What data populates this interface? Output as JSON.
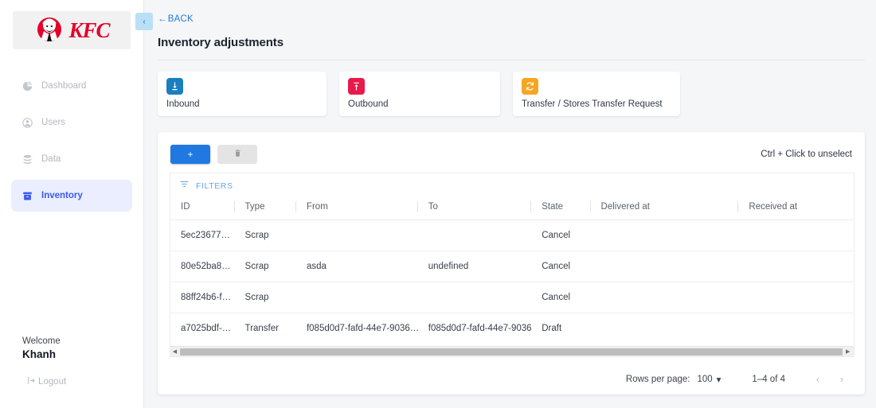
{
  "sidebar": {
    "brand": {
      "name": "KFC",
      "logo_alt": "kfc-logo"
    },
    "collapse_label": "‹",
    "items": [
      {
        "label": "Dashboard",
        "icon": "pie-chart-icon",
        "active": false
      },
      {
        "label": "Users",
        "icon": "user-icon",
        "active": false
      },
      {
        "label": "Data",
        "icon": "database-icon",
        "active": false
      },
      {
        "label": "Inventory",
        "icon": "inventory-box-icon",
        "active": true
      }
    ],
    "footer": {
      "welcome_label": "Welcome",
      "user_name": "Khanh",
      "logout_label": "Logout",
      "logout_icon": "logout-icon"
    }
  },
  "header": {
    "back_label": "BACK",
    "back_icon": "arrow-left-icon",
    "page_title": "Inventory adjustments"
  },
  "cards": [
    {
      "label": "Inbound",
      "icon": "download-inbound-icon",
      "color": "#1a7fc1"
    },
    {
      "label": "Outbound",
      "icon": "upload-outbound-icon",
      "color": "#e8194b"
    },
    {
      "label": "Transfer / Stores Transfer Request",
      "icon": "refresh-transfer-icon",
      "color": "#f5a623"
    }
  ],
  "toolbar": {
    "add_label": "+",
    "delete_icon": "trash-icon",
    "hint_text": "Ctrl + Click to unselect"
  },
  "table": {
    "filters_label": "FILTERS",
    "filters_icon": "filter-icon",
    "columns": [
      "ID",
      "Type",
      "From",
      "To",
      "State",
      "Delivered at",
      "Received at"
    ],
    "rows": [
      {
        "id": "5ec23677…",
        "type": "Scrap",
        "from": "",
        "to": "",
        "state": "Cancel",
        "delivered_at": "",
        "received_at": ""
      },
      {
        "id": "80e52ba8…",
        "type": "Scrap",
        "from": "asda",
        "to": "undefined",
        "state": "Cancel",
        "delivered_at": "",
        "received_at": ""
      },
      {
        "id": "88ff24b6-f…",
        "type": "Scrap",
        "from": "",
        "to": "",
        "state": "Cancel",
        "delivered_at": "",
        "received_at": ""
      },
      {
        "id": "a7025bdf-…",
        "type": "Transfer",
        "from": "f085d0d7-fafd-44e7-9036…",
        "to": "f085d0d7-fafd-44e7-9036…",
        "state": "Draft",
        "delivered_at": "",
        "received_at": ""
      }
    ]
  },
  "pagination": {
    "rows_per_page_label": "Rows per page:",
    "rows_per_page_value": "100",
    "range_label": "1–4 of 4",
    "prev_icon": "chevron-left-icon",
    "next_icon": "chevron-right-icon"
  }
}
